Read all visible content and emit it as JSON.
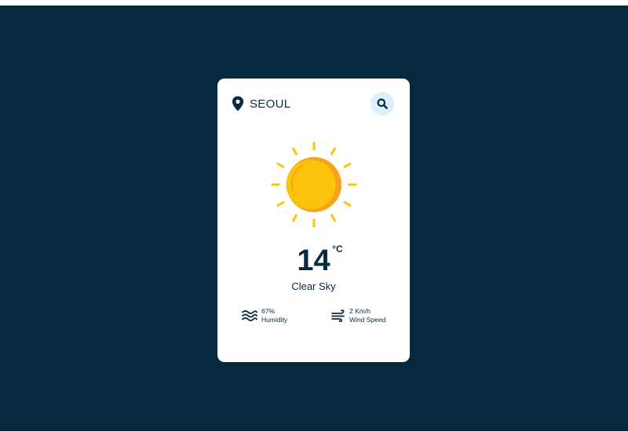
{
  "location": {
    "city": "SEOUL",
    "icon": "map-pin-icon"
  },
  "search": {
    "icon": "search-icon"
  },
  "weather": {
    "icon": "sun-icon",
    "temperature": "14",
    "unit": "°C",
    "condition": "Clear Sky"
  },
  "stats": {
    "humidity": {
      "value": "67%",
      "label": "Humidity",
      "icon": "waves-icon"
    },
    "wind": {
      "value": "2 Km/h",
      "label": "Wind Speed",
      "icon": "wind-icon"
    }
  },
  "colors": {
    "background": "#08283d",
    "card": "#ffffff",
    "text": "#0a2a3f",
    "search_bg": "#dcf0fb",
    "sun": "#fbc40a",
    "sun_shade": "#f7a21d"
  }
}
